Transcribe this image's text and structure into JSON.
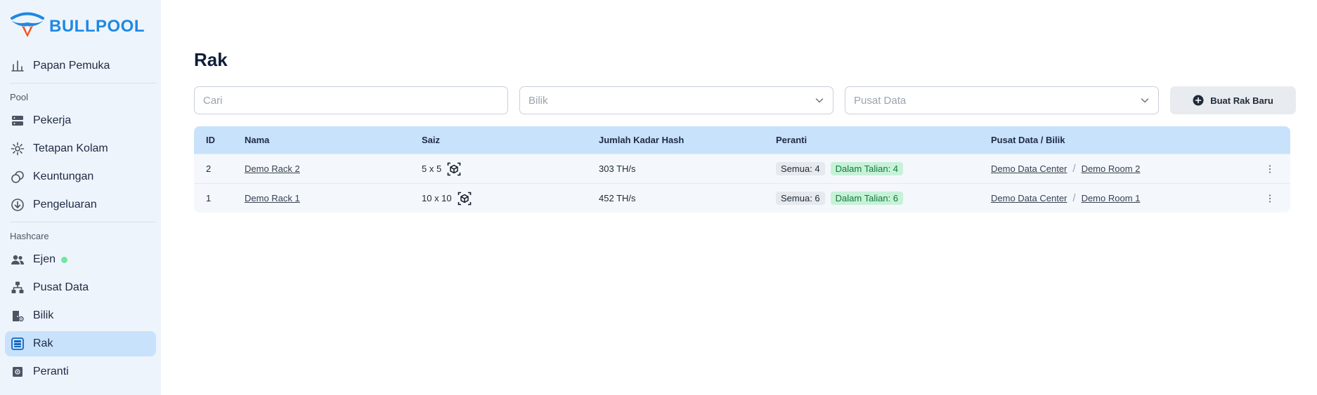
{
  "brand": {
    "name": "BULLPOOL"
  },
  "sidebar": {
    "top_item": {
      "label": "Papan Pemuka",
      "icon": "bar-chart-icon"
    },
    "sections": [
      {
        "label": "Pool",
        "items": [
          {
            "label": "Pekerja",
            "icon": "server-icon"
          },
          {
            "label": "Tetapan Kolam",
            "icon": "gear-icon"
          },
          {
            "label": "Keuntungan",
            "icon": "coins-icon"
          },
          {
            "label": "Pengeluaran",
            "icon": "download-circle-icon"
          }
        ]
      },
      {
        "label": "Hashcare",
        "items": [
          {
            "label": "Ejen",
            "icon": "users-icon"
          },
          {
            "label": "Pusat Data",
            "icon": "network-icon"
          },
          {
            "label": "Bilik",
            "icon": "door-icon"
          },
          {
            "label": "Rak",
            "icon": "rack-icon",
            "active": true
          },
          {
            "label": "Peranti",
            "icon": "chip-icon"
          }
        ]
      }
    ]
  },
  "main": {
    "title": "Rak",
    "search": {
      "placeholder": "Cari",
      "value": ""
    },
    "filters": {
      "room_placeholder": "Bilik",
      "datacenter_placeholder": "Pusat Data"
    },
    "new_button_label": "Buat Rak Baru",
    "table": {
      "headers": {
        "id": "ID",
        "nama": "Nama",
        "saiz": "Saiz",
        "hash": "Jumlah Kadar Hash",
        "peranti": "Peranti",
        "pusat": "Pusat Data / Bilik"
      },
      "rows": [
        {
          "id": "2",
          "nama": "Demo Rack 2",
          "saiz": "5 x 5",
          "hash": "303 TH/s",
          "semua": "Semua: 4",
          "talian": "Dalam Talian: 4",
          "pusat_data": "Demo Data Center",
          "bilik": "Demo Room 2"
        },
        {
          "id": "1",
          "nama": "Demo Rack 1",
          "saiz": "10 x 10",
          "hash": "452 TH/s",
          "semua": "Semua: 6",
          "talian": "Dalam Talian: 6",
          "pusat_data": "Demo Data Center",
          "bilik": "Demo Room 1"
        }
      ]
    }
  },
  "colors": {
    "brand": "#1e88e5",
    "logo_accent": "#f4511e",
    "active_bg": "#c8e2fb",
    "online": "#6ee7a1"
  }
}
